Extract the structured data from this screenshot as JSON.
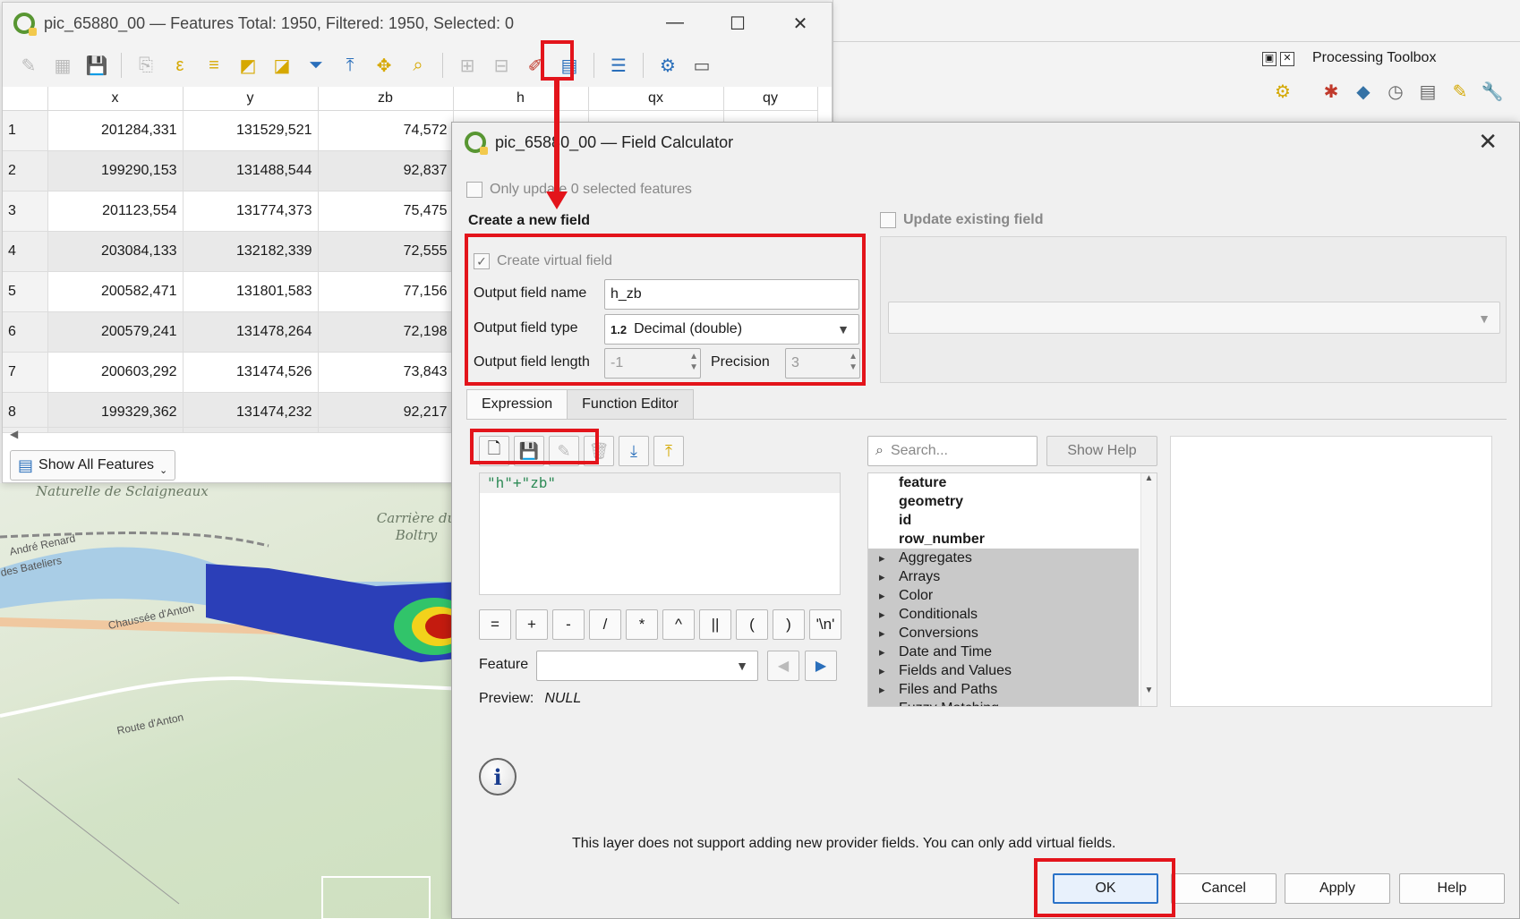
{
  "attr_window": {
    "title": "pic_65880_00 — Features Total: 1950, Filtered: 1950, Selected: 0",
    "columns": [
      "x",
      "y",
      "zb",
      "h",
      "qx",
      "qy"
    ],
    "rows": [
      {
        "n": "1",
        "x": "201284,331",
        "y": "131529,521",
        "zb": "74,572"
      },
      {
        "n": "2",
        "x": "199290,153",
        "y": "131488,544",
        "zb": "92,837"
      },
      {
        "n": "3",
        "x": "201123,554",
        "y": "131774,373",
        "zb": "75,475"
      },
      {
        "n": "4",
        "x": "203084,133",
        "y": "132182,339",
        "zb": "72,555"
      },
      {
        "n": "5",
        "x": "200582,471",
        "y": "131801,583",
        "zb": "77,156"
      },
      {
        "n": "6",
        "x": "200579,241",
        "y": "131478,264",
        "zb": "72,198"
      },
      {
        "n": "7",
        "x": "200603,292",
        "y": "131474,526",
        "zb": "73,843"
      },
      {
        "n": "8",
        "x": "199329,362",
        "y": "131474,232",
        "zb": "92,217"
      }
    ],
    "show_all_label": "Show All Features"
  },
  "main_window": {
    "processing_title": "Processing Toolbox"
  },
  "map": {
    "labels": [
      "Naturelle de Sclaigneaux",
      "Carrière du Boltry",
      "Chaussée d'Anton",
      "Route d'Anton",
      "André Renard",
      "des Bateliers"
    ]
  },
  "dialog": {
    "title": "pic_65880_00 — Field Calculator",
    "only_update_label": "Only update 0 selected features",
    "create_new_label": "Create a new field",
    "update_existing_label": "Update existing field",
    "create_virtual_label": "Create virtual field",
    "output_name_label": "Output field name",
    "output_name_value": "h_zb",
    "output_type_label": "Output field type",
    "output_type_badge": "1.2",
    "output_type_value": "Decimal (double)",
    "output_length_label": "Output field length",
    "output_length_value": "-1",
    "precision_label": "Precision",
    "precision_value": "3",
    "tabs": [
      "Expression",
      "Function Editor"
    ],
    "expression": "\"h\"+\"zb\"",
    "operators": [
      "=",
      "+",
      "-",
      "/",
      "*",
      "^",
      "||",
      "(",
      ")",
      "'\\n'"
    ],
    "feature_label": "Feature",
    "preview_label": "Preview:",
    "preview_value": "NULL",
    "search_placeholder": "Search...",
    "show_help_label": "Show Help",
    "fields": [
      "feature",
      "geometry",
      "id",
      "row_number"
    ],
    "groups": [
      "Aggregates",
      "Arrays",
      "Color",
      "Conditionals",
      "Conversions",
      "Date and Time",
      "Fields and Values",
      "Files and Paths",
      "Fuzzy Matching"
    ],
    "info_message": "This layer does not support adding new provider fields. You can only add virtual fields.",
    "buttons": {
      "ok": "OK",
      "cancel": "Cancel",
      "apply": "Apply",
      "help": "Help"
    }
  },
  "colors": {
    "highlight": "#e3141b",
    "qgis_green": "#589632"
  }
}
